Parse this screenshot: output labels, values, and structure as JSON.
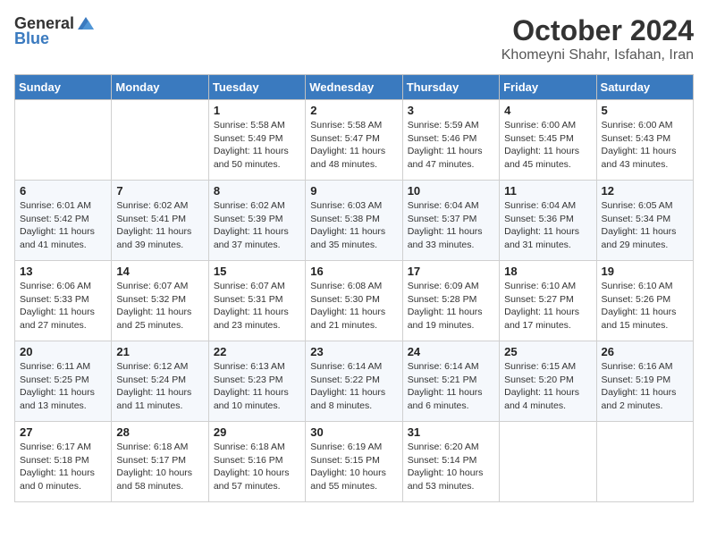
{
  "logo": {
    "text_general": "General",
    "text_blue": "Blue"
  },
  "title": "October 2024",
  "location": "Khomeyni Shahr, Isfahan, Iran",
  "days_of_week": [
    "Sunday",
    "Monday",
    "Tuesday",
    "Wednesday",
    "Thursday",
    "Friday",
    "Saturday"
  ],
  "weeks": [
    [
      {
        "day": "",
        "sunrise": "",
        "sunset": "",
        "daylight": ""
      },
      {
        "day": "",
        "sunrise": "",
        "sunset": "",
        "daylight": ""
      },
      {
        "day": "1",
        "sunrise": "Sunrise: 5:58 AM",
        "sunset": "Sunset: 5:49 PM",
        "daylight": "Daylight: 11 hours and 50 minutes."
      },
      {
        "day": "2",
        "sunrise": "Sunrise: 5:58 AM",
        "sunset": "Sunset: 5:47 PM",
        "daylight": "Daylight: 11 hours and 48 minutes."
      },
      {
        "day": "3",
        "sunrise": "Sunrise: 5:59 AM",
        "sunset": "Sunset: 5:46 PM",
        "daylight": "Daylight: 11 hours and 47 minutes."
      },
      {
        "day": "4",
        "sunrise": "Sunrise: 6:00 AM",
        "sunset": "Sunset: 5:45 PM",
        "daylight": "Daylight: 11 hours and 45 minutes."
      },
      {
        "day": "5",
        "sunrise": "Sunrise: 6:00 AM",
        "sunset": "Sunset: 5:43 PM",
        "daylight": "Daylight: 11 hours and 43 minutes."
      }
    ],
    [
      {
        "day": "6",
        "sunrise": "Sunrise: 6:01 AM",
        "sunset": "Sunset: 5:42 PM",
        "daylight": "Daylight: 11 hours and 41 minutes."
      },
      {
        "day": "7",
        "sunrise": "Sunrise: 6:02 AM",
        "sunset": "Sunset: 5:41 PM",
        "daylight": "Daylight: 11 hours and 39 minutes."
      },
      {
        "day": "8",
        "sunrise": "Sunrise: 6:02 AM",
        "sunset": "Sunset: 5:39 PM",
        "daylight": "Daylight: 11 hours and 37 minutes."
      },
      {
        "day": "9",
        "sunrise": "Sunrise: 6:03 AM",
        "sunset": "Sunset: 5:38 PM",
        "daylight": "Daylight: 11 hours and 35 minutes."
      },
      {
        "day": "10",
        "sunrise": "Sunrise: 6:04 AM",
        "sunset": "Sunset: 5:37 PM",
        "daylight": "Daylight: 11 hours and 33 minutes."
      },
      {
        "day": "11",
        "sunrise": "Sunrise: 6:04 AM",
        "sunset": "Sunset: 5:36 PM",
        "daylight": "Daylight: 11 hours and 31 minutes."
      },
      {
        "day": "12",
        "sunrise": "Sunrise: 6:05 AM",
        "sunset": "Sunset: 5:34 PM",
        "daylight": "Daylight: 11 hours and 29 minutes."
      }
    ],
    [
      {
        "day": "13",
        "sunrise": "Sunrise: 6:06 AM",
        "sunset": "Sunset: 5:33 PM",
        "daylight": "Daylight: 11 hours and 27 minutes."
      },
      {
        "day": "14",
        "sunrise": "Sunrise: 6:07 AM",
        "sunset": "Sunset: 5:32 PM",
        "daylight": "Daylight: 11 hours and 25 minutes."
      },
      {
        "day": "15",
        "sunrise": "Sunrise: 6:07 AM",
        "sunset": "Sunset: 5:31 PM",
        "daylight": "Daylight: 11 hours and 23 minutes."
      },
      {
        "day": "16",
        "sunrise": "Sunrise: 6:08 AM",
        "sunset": "Sunset: 5:30 PM",
        "daylight": "Daylight: 11 hours and 21 minutes."
      },
      {
        "day": "17",
        "sunrise": "Sunrise: 6:09 AM",
        "sunset": "Sunset: 5:28 PM",
        "daylight": "Daylight: 11 hours and 19 minutes."
      },
      {
        "day": "18",
        "sunrise": "Sunrise: 6:10 AM",
        "sunset": "Sunset: 5:27 PM",
        "daylight": "Daylight: 11 hours and 17 minutes."
      },
      {
        "day": "19",
        "sunrise": "Sunrise: 6:10 AM",
        "sunset": "Sunset: 5:26 PM",
        "daylight": "Daylight: 11 hours and 15 minutes."
      }
    ],
    [
      {
        "day": "20",
        "sunrise": "Sunrise: 6:11 AM",
        "sunset": "Sunset: 5:25 PM",
        "daylight": "Daylight: 11 hours and 13 minutes."
      },
      {
        "day": "21",
        "sunrise": "Sunrise: 6:12 AM",
        "sunset": "Sunset: 5:24 PM",
        "daylight": "Daylight: 11 hours and 11 minutes."
      },
      {
        "day": "22",
        "sunrise": "Sunrise: 6:13 AM",
        "sunset": "Sunset: 5:23 PM",
        "daylight": "Daylight: 11 hours and 10 minutes."
      },
      {
        "day": "23",
        "sunrise": "Sunrise: 6:14 AM",
        "sunset": "Sunset: 5:22 PM",
        "daylight": "Daylight: 11 hours and 8 minutes."
      },
      {
        "day": "24",
        "sunrise": "Sunrise: 6:14 AM",
        "sunset": "Sunset: 5:21 PM",
        "daylight": "Daylight: 11 hours and 6 minutes."
      },
      {
        "day": "25",
        "sunrise": "Sunrise: 6:15 AM",
        "sunset": "Sunset: 5:20 PM",
        "daylight": "Daylight: 11 hours and 4 minutes."
      },
      {
        "day": "26",
        "sunrise": "Sunrise: 6:16 AM",
        "sunset": "Sunset: 5:19 PM",
        "daylight": "Daylight: 11 hours and 2 minutes."
      }
    ],
    [
      {
        "day": "27",
        "sunrise": "Sunrise: 6:17 AM",
        "sunset": "Sunset: 5:18 PM",
        "daylight": "Daylight: 11 hours and 0 minutes."
      },
      {
        "day": "28",
        "sunrise": "Sunrise: 6:18 AM",
        "sunset": "Sunset: 5:17 PM",
        "daylight": "Daylight: 10 hours and 58 minutes."
      },
      {
        "day": "29",
        "sunrise": "Sunrise: 6:18 AM",
        "sunset": "Sunset: 5:16 PM",
        "daylight": "Daylight: 10 hours and 57 minutes."
      },
      {
        "day": "30",
        "sunrise": "Sunrise: 6:19 AM",
        "sunset": "Sunset: 5:15 PM",
        "daylight": "Daylight: 10 hours and 55 minutes."
      },
      {
        "day": "31",
        "sunrise": "Sunrise: 6:20 AM",
        "sunset": "Sunset: 5:14 PM",
        "daylight": "Daylight: 10 hours and 53 minutes."
      },
      {
        "day": "",
        "sunrise": "",
        "sunset": "",
        "daylight": ""
      },
      {
        "day": "",
        "sunrise": "",
        "sunset": "",
        "daylight": ""
      }
    ]
  ]
}
